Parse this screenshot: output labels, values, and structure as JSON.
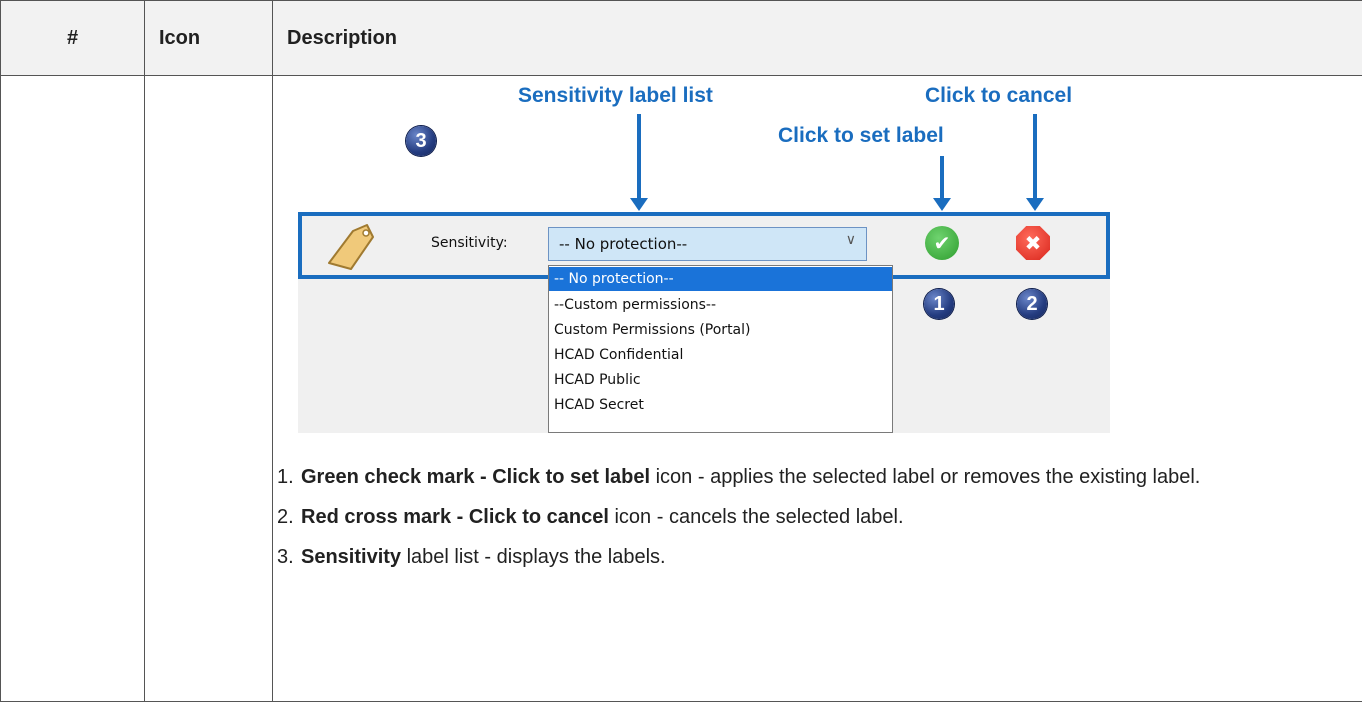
{
  "table": {
    "headers": [
      "#",
      "Icon",
      "Description"
    ]
  },
  "figure": {
    "annot_list": "Sensitivity label list",
    "annot_cancel": "Click to cancel",
    "annot_set": "Click to set label",
    "badge_3": "3",
    "badge_1": "1",
    "badge_2": "2",
    "sensitivity_label": "Sensitivity:",
    "select_value": "-- No protection--",
    "select_chevron": "∨",
    "dropdown": [
      "-- No protection--",
      " --Custom permissions--",
      "Custom Permissions (Portal)",
      "HCAD Confidential",
      "HCAD Public",
      "HCAD Secret"
    ],
    "ok_glyph": "✔",
    "cancel_glyph": "✖"
  },
  "notes": [
    {
      "num": "1.",
      "bold": "Green check mark - Click to set label",
      "rest": " icon - applies the selected label or removes the existing label."
    },
    {
      "num": "2.",
      "bold": "Red cross mark - Click to cancel",
      "rest": " icon - cancels the selected label."
    },
    {
      "num": "3.",
      "bold": "Sensitivity",
      "rest": " label list - displays the labels."
    }
  ],
  "colors": {
    "accent": "#1a6dbf",
    "selected": "#1a73d9",
    "ok": "#2e9d2e",
    "cancel": "#d9261c"
  }
}
